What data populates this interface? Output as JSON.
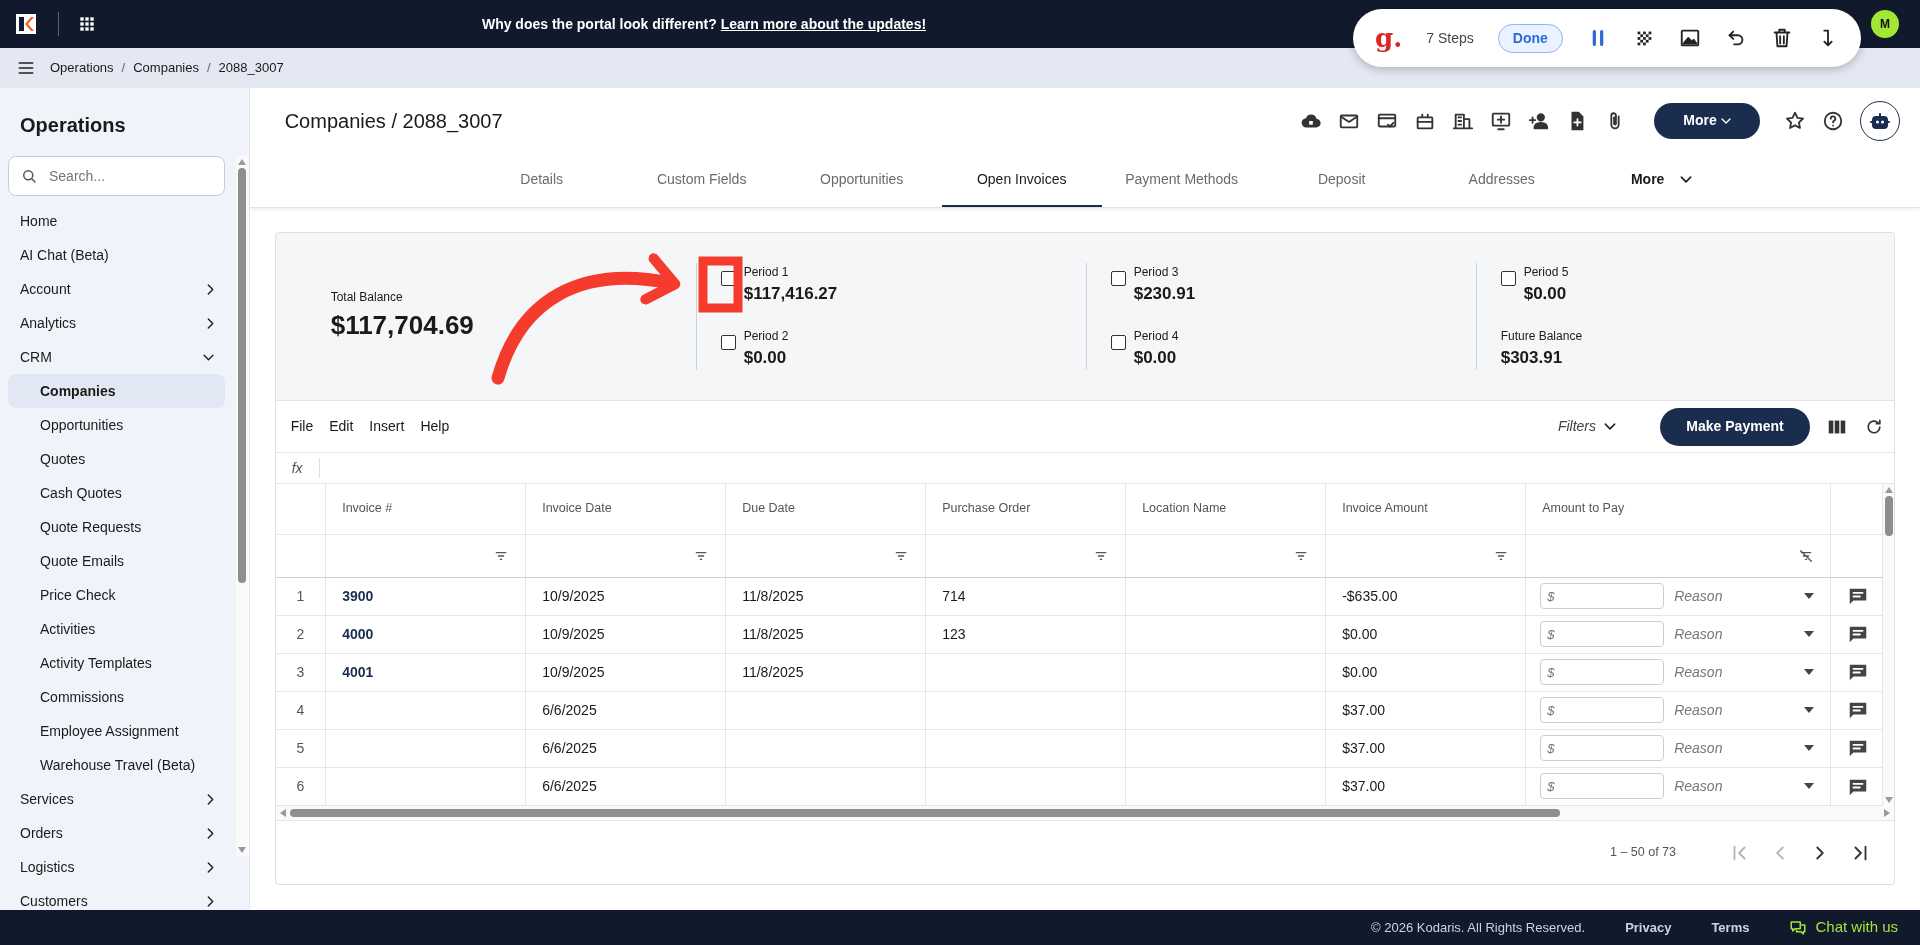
{
  "topbar": {
    "banner_text": "Why does the portal look different?",
    "banner_link": "Learn more about the updates!",
    "avatar": "M"
  },
  "guide_toolbar": {
    "logo": "g.",
    "steps": "7 Steps",
    "done": "Done"
  },
  "breadcrumb": {
    "items": [
      "Operations",
      "Companies",
      "2088_3007"
    ],
    "separator": "/"
  },
  "sidebar": {
    "title": "Operations",
    "search": {
      "placeholder": "Search..."
    },
    "items": [
      {
        "label": "Home",
        "kind": "link",
        "selected": false
      },
      {
        "label": "AI Chat (Beta)",
        "kind": "link",
        "selected": false
      },
      {
        "label": "Account",
        "kind": "group",
        "expanded": false,
        "selected": false
      },
      {
        "label": "Analytics",
        "kind": "group",
        "expanded": false,
        "selected": false
      },
      {
        "label": "CRM",
        "kind": "group",
        "expanded": true,
        "selected": false,
        "children": [
          {
            "label": "Companies",
            "selected": true
          },
          {
            "label": "Opportunities",
            "selected": false
          },
          {
            "label": "Quotes",
            "selected": false
          },
          {
            "label": "Cash Quotes",
            "selected": false
          },
          {
            "label": "Quote Requests",
            "selected": false
          },
          {
            "label": "Quote Emails",
            "selected": false
          },
          {
            "label": "Price Check",
            "selected": false
          },
          {
            "label": "Activities",
            "selected": false
          },
          {
            "label": "Activity Templates",
            "selected": false
          },
          {
            "label": "Commissions",
            "selected": false
          },
          {
            "label": "Employee Assignment",
            "selected": false
          },
          {
            "label": "Warehouse Travel (Beta)",
            "selected": false
          }
        ]
      },
      {
        "label": "Services",
        "kind": "group",
        "expanded": false,
        "selected": false
      },
      {
        "label": "Orders",
        "kind": "group",
        "expanded": false,
        "selected": false
      },
      {
        "label": "Logistics",
        "kind": "group",
        "expanded": false,
        "selected": false
      },
      {
        "label": "Customers",
        "kind": "group",
        "expanded": false,
        "selected": false
      }
    ]
  },
  "header": {
    "title": "Companies / 2088_3007",
    "more_button": "More"
  },
  "tabs": [
    {
      "label": "Details",
      "selected": false
    },
    {
      "label": "Custom Fields",
      "selected": false
    },
    {
      "label": "Opportunities",
      "selected": false
    },
    {
      "label": "Open Invoices",
      "selected": true
    },
    {
      "label": "Payment Methods",
      "selected": false
    },
    {
      "label": "Deposit",
      "selected": false
    },
    {
      "label": "Addresses",
      "selected": false
    }
  ],
  "tabs_more": "More",
  "summary": {
    "total_label": "Total Balance",
    "total_value": "$117,704.69",
    "columns": [
      [
        {
          "kind": "period",
          "label": "Period 1",
          "value": "$117,416.27",
          "checked": false
        },
        {
          "kind": "period",
          "label": "Period 2",
          "value": "$0.00",
          "checked": false
        }
      ],
      [
        {
          "kind": "period",
          "label": "Period 3",
          "value": "$230.91",
          "checked": false
        },
        {
          "kind": "period",
          "label": "Period 4",
          "value": "$0.00",
          "checked": false
        }
      ],
      [
        {
          "kind": "period",
          "label": "Period 5",
          "value": "$0.00",
          "checked": false
        },
        {
          "kind": "balance",
          "label": "Future Balance",
          "value": "$303.91"
        }
      ]
    ]
  },
  "toolbar": {
    "menu": [
      "File",
      "Edit",
      "Insert",
      "Help"
    ],
    "filters": "Filters",
    "make_payment": "Make Payment"
  },
  "formula_bar": {
    "label": "fx"
  },
  "table": {
    "columns": [
      "Invoice #",
      "Invoice Date",
      "Due Date",
      "Purchase Order",
      "Location Name",
      "Invoice Amount",
      "Amount to Pay"
    ],
    "rows": [
      {
        "number": "1",
        "invoice_number": "3900",
        "invoice_date": "10/9/2025",
        "due_date": "11/8/2025",
        "purchase_order": "714",
        "invoice_amount": "-$635.00",
        "amount_placeholder": "$",
        "reason_placeholder": "Reason"
      },
      {
        "number": "2",
        "invoice_number": "4000",
        "invoice_date": "10/9/2025",
        "due_date": "11/8/2025",
        "purchase_order": "123",
        "invoice_amount": "$0.00",
        "amount_placeholder": "$",
        "reason_placeholder": "Reason"
      },
      {
        "number": "3",
        "invoice_number": "4001",
        "invoice_date": "10/9/2025",
        "due_date": "11/8/2025",
        "invoice_amount": "$0.00",
        "amount_placeholder": "$",
        "reason_placeholder": "Reason"
      },
      {
        "number": "4",
        "invoice_date": "6/6/2025",
        "invoice_amount": "$37.00",
        "amount_placeholder": "$",
        "reason_placeholder": "Reason"
      },
      {
        "number": "5",
        "invoice_date": "6/6/2025",
        "invoice_amount": "$37.00",
        "amount_placeholder": "$",
        "reason_placeholder": "Reason"
      },
      {
        "number": "6",
        "invoice_date": "6/6/2025",
        "invoice_amount": "$37.00",
        "amount_placeholder": "$",
        "reason_placeholder": "Reason"
      }
    ]
  },
  "pagination": {
    "range": "1 – 50 of 73",
    "buttons": [
      {
        "kind": "first",
        "disabled": true
      },
      {
        "kind": "prev",
        "disabled": true
      },
      {
        "kind": "next",
        "disabled": false
      },
      {
        "kind": "last",
        "disabled": false
      }
    ]
  },
  "footer": {
    "copyright": "© 2026 Kodaris. All Rights Reserved.",
    "links": [
      "Privacy",
      "Terms"
    ],
    "chat": "Chat with us"
  }
}
